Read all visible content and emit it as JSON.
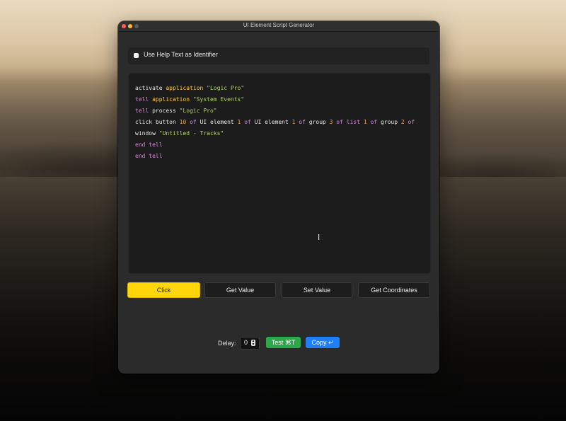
{
  "window": {
    "title": "UI Element Script Generator"
  },
  "options": {
    "help_text_label": "Use Help Text as Identifier",
    "help_text_checked": false
  },
  "script_lines": [
    [
      {
        "t": "activate ",
        "c": ""
      },
      {
        "t": "application",
        "c": "kw"
      },
      {
        "t": " ",
        "c": ""
      },
      {
        "t": "\"Logic Pro\"",
        "c": "str"
      }
    ],
    [
      {
        "t": "tell",
        "c": "kw2"
      },
      {
        "t": " ",
        "c": ""
      },
      {
        "t": "application",
        "c": "kw"
      },
      {
        "t": " ",
        "c": ""
      },
      {
        "t": "\"System Events\"",
        "c": "str"
      }
    ],
    [
      {
        "t": "tell",
        "c": "kw2"
      },
      {
        "t": " process ",
        "c": ""
      },
      {
        "t": "\"Logic Pro\"",
        "c": "str"
      }
    ],
    [
      {
        "t": "click button ",
        "c": ""
      },
      {
        "t": "10",
        "c": "num"
      },
      {
        "t": " ",
        "c": ""
      },
      {
        "t": "of",
        "c": "op"
      },
      {
        "t": " UI element ",
        "c": ""
      },
      {
        "t": "1",
        "c": "num"
      },
      {
        "t": " ",
        "c": ""
      },
      {
        "t": "of",
        "c": "op"
      },
      {
        "t": " UI element ",
        "c": ""
      },
      {
        "t": "1",
        "c": "num"
      },
      {
        "t": " ",
        "c": ""
      },
      {
        "t": "of",
        "c": "op"
      },
      {
        "t": " group ",
        "c": ""
      },
      {
        "t": "3",
        "c": "num"
      },
      {
        "t": " ",
        "c": ""
      },
      {
        "t": "of",
        "c": "op"
      },
      {
        "t": " ",
        "c": ""
      },
      {
        "t": "list",
        "c": "kw2"
      },
      {
        "t": " ",
        "c": ""
      },
      {
        "t": "1",
        "c": "num"
      },
      {
        "t": " ",
        "c": ""
      },
      {
        "t": "of",
        "c": "op"
      },
      {
        "t": " group ",
        "c": ""
      },
      {
        "t": "2",
        "c": "num"
      },
      {
        "t": " ",
        "c": ""
      },
      {
        "t": "of",
        "c": "op"
      }
    ],
    [
      {
        "t": "window ",
        "c": ""
      },
      {
        "t": "\"Untitled - Tracks\"",
        "c": "str"
      }
    ],
    [
      {
        "t": "end tell",
        "c": "kw2"
      }
    ],
    [
      {
        "t": "end tell",
        "c": "kw2"
      }
    ]
  ],
  "actions": {
    "click": "Click",
    "get_value": "Get Value",
    "set_value": "Set Value",
    "get_coordinates": "Get Coordinates",
    "selected": "click"
  },
  "footer": {
    "delay_label": "Delay:",
    "delay_value": "0",
    "test_label": "Test ⌘T",
    "copy_label": "Copy ↵"
  },
  "colors": {
    "accent_selected": "#ffd60a",
    "test_button": "#2aa84a",
    "copy_button": "#1e7ef5",
    "keyword": "#ffcc3d",
    "control_keyword": "#d38ad8",
    "string": "#b2d86d",
    "number": "#f2a14a"
  }
}
